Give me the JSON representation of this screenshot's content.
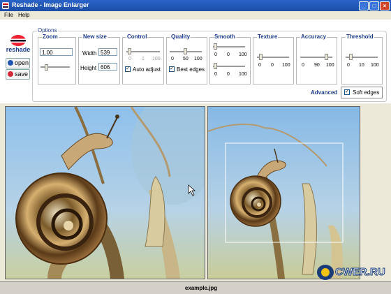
{
  "window": {
    "title": "Reshade - Image Enlarger",
    "controls": [
      "_",
      "□",
      "×"
    ]
  },
  "menu": [
    "File",
    "Help"
  ],
  "brand": "reshade",
  "side_buttons": {
    "open": "open",
    "save": "save"
  },
  "options": {
    "legend": "Options",
    "zoom": {
      "title": "Zoom",
      "value": "1.00"
    },
    "newsize": {
      "title": "New size",
      "width_label": "Width",
      "width": "539",
      "height_label": "Height",
      "height": "606"
    },
    "control": {
      "title": "Control",
      "ticks": [
        "0",
        "1",
        "100"
      ],
      "auto_adjust": "Auto adjust",
      "auto_adjust_checked": true
    },
    "quality": {
      "title": "Quality",
      "ticks": [
        "0",
        "50",
        "100"
      ],
      "best_edges": "Best edges",
      "best_edges_checked": true
    },
    "smooth": {
      "title": "Smooth",
      "ticks1": [
        "0",
        "0",
        "100"
      ],
      "ticks2": [
        "0",
        "0",
        "100"
      ]
    },
    "texture": {
      "title": "Texture",
      "ticks": [
        "0",
        "0",
        "100"
      ]
    },
    "accuracy": {
      "title": "Accuracy",
      "ticks": [
        "0",
        "90",
        "100"
      ]
    },
    "threshold": {
      "title": "Threshold",
      "ticks": [
        "0",
        "10",
        "100"
      ]
    },
    "advanced": "Advanced",
    "soft_edges": "Soft edges",
    "soft_edges_checked": true
  },
  "status": {
    "filename": "example.jpg"
  },
  "watermark": "CWER.RU",
  "colors": {
    "title_bar": "#2a63c8",
    "accent": "#1e3c8c",
    "brand_red": "#e22233",
    "sky": "#9cc4e8"
  }
}
